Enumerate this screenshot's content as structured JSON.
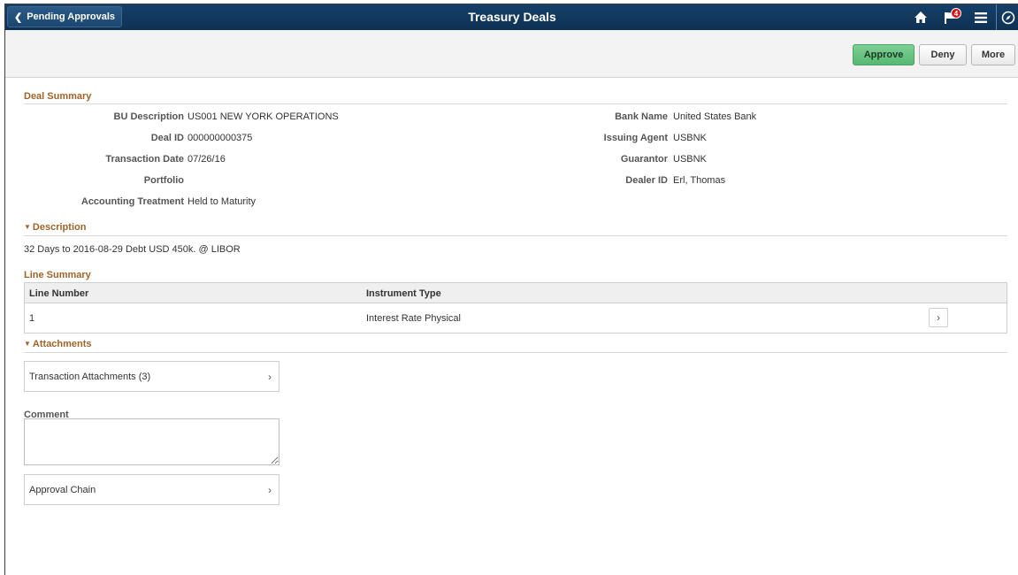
{
  "header": {
    "back_label": "Pending Approvals",
    "title": "Treasury Deals",
    "notification_count": "4",
    "icons": [
      "home-icon",
      "flag-icon",
      "menu-icon",
      "navigator-icon"
    ]
  },
  "actions": {
    "approve": "Approve",
    "deny": "Deny",
    "more": "More",
    "approve_color": "#5cbd76"
  },
  "deal_summary": {
    "title": "Deal Summary",
    "left_fields": [
      {
        "label": "BU Description",
        "value": "US001 NEW YORK OPERATIONS"
      },
      {
        "label": "Deal ID",
        "value": "000000000375"
      },
      {
        "label": "Transaction Date",
        "value": "07/26/16"
      },
      {
        "label": "Portfolio",
        "value": ""
      },
      {
        "label": "Accounting Treatment",
        "value": "Held to Maturity"
      }
    ],
    "right_fields": [
      {
        "label": "Bank Name",
        "value": "United States Bank"
      },
      {
        "label": "Issuing Agent",
        "value": "USBNK"
      },
      {
        "label": "Guarantor",
        "value": "USBNK"
      },
      {
        "label": "Dealer ID",
        "value": "Erl, Thomas"
      }
    ]
  },
  "description": {
    "title": "Description",
    "text": "32 Days to 2016-08-29 Debt USD 450k. @ LIBOR"
  },
  "line_summary": {
    "title": "Line Summary",
    "columns": [
      "Line Number",
      "Instrument Type"
    ],
    "rows": [
      {
        "line_number": "1",
        "instrument_type": "Interest Rate Physical"
      }
    ]
  },
  "attachments": {
    "title": "Attachments",
    "link_label": "Transaction Attachments (3)"
  },
  "comment": {
    "label": "Comment",
    "value": ""
  },
  "approval_chain": {
    "label": "Approval Chain"
  },
  "colors": {
    "header_bg": "#10375a",
    "section_title": "#a0642a",
    "badge": "#d6181e"
  }
}
